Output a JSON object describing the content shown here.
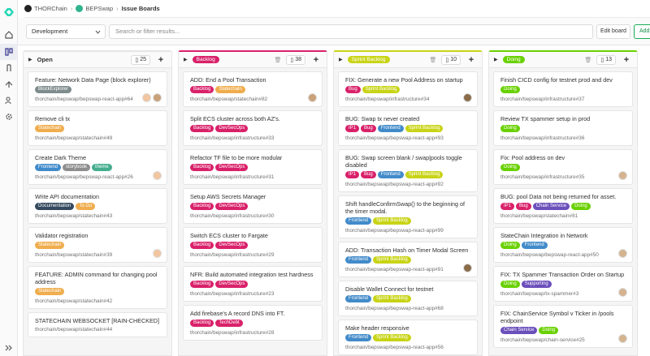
{
  "breadcrumb": [
    "THORChain",
    "BEPSwap",
    "Issue Boards"
  ],
  "filter": {
    "board_select": "Development",
    "search_placeholder": "Search or filter results...",
    "edit_board": "Edit board",
    "add_list": "Add list"
  },
  "colors": {
    "green": "#1aaa55",
    "accent": "#6b4fbb"
  },
  "lists": [
    {
      "title": "Open",
      "label": false,
      "count": "25",
      "top_color": "#e5e5e5",
      "cards": [
        {
          "title": "Feature: Network Data Page (block explorer)",
          "tags": [
            {
              "t": "BlockExplorer",
              "c": "#7f8c8d"
            }
          ],
          "ref": "thorchain/bepswap/bepswap-react-app#64",
          "avatars": 2
        },
        {
          "title": "Remove cli tx",
          "tags": [
            {
              "t": "Statechain",
              "c": "#f0ad4e"
            }
          ],
          "ref": "thorchain/bepswap/statechain#49",
          "avatars": 0
        },
        {
          "title": "Create Dark Theme",
          "tags": [
            {
              "t": "Frontend",
              "c": "#428bca"
            },
            {
              "t": "storybook",
              "c": "#8e8e8e"
            },
            {
              "t": "theme",
              "c": "#44ad8e"
            }
          ],
          "ref": "thorchain/bepswap/bepswap-react-app#26",
          "avatars": 1
        },
        {
          "title": "Write API documentation",
          "tags": [
            {
              "t": "Documentation",
              "c": "#34495e"
            },
            {
              "t": "To Do",
              "c": "#f0ad4e"
            }
          ],
          "ref": "thorchain/bepswap/statechain#43",
          "avatars": 0
        },
        {
          "title": "Validator registration",
          "tags": [
            {
              "t": "Statechain",
              "c": "#f0ad4e"
            }
          ],
          "ref": "thorchain/bepswap/statechain#39",
          "avatars": 1
        },
        {
          "title": "FEATURE: ADMIN command for changing pool address",
          "tags": [
            {
              "t": "Statechain",
              "c": "#f0ad4e"
            }
          ],
          "ref": "thorchain/bepswap/statechain#42",
          "avatars": 0
        },
        {
          "title": "STATECHAIN WEBSOCKET [RAIN-CHECKED]",
          "tags": [],
          "ref": "thorchain/bepswap/statechain#44",
          "avatars": 0
        }
      ]
    },
    {
      "title": "Backlog",
      "label": true,
      "label_color": "#d9216a",
      "count": "38",
      "top_color": "#d9216a",
      "cards": [
        {
          "title": "ADD: End a Pool Transaction",
          "tags": [
            {
              "t": "Backlog",
              "c": "#d9216a"
            },
            {
              "t": "Statechain",
              "c": "#f0ad4e"
            }
          ],
          "ref": "thorchain/bepswap/statechain#82",
          "avatars": 1
        },
        {
          "title": "Split ECS cluster across both AZ's.",
          "tags": [
            {
              "t": "Backlog",
              "c": "#d9216a"
            },
            {
              "t": "DevSecOps",
              "c": "#d9216a"
            }
          ],
          "ref": "thorchain/bepswap/infrastructure#33",
          "avatars": 0
        },
        {
          "title": "Refactor TF file to be more modular",
          "tags": [
            {
              "t": "Backlog",
              "c": "#d9216a"
            },
            {
              "t": "DevSecOps",
              "c": "#d9216a"
            }
          ],
          "ref": "thorchain/bepswap/infrastructure#31",
          "avatars": 0
        },
        {
          "title": "Setup AWS Secrets Manager",
          "tags": [
            {
              "t": "Backlog",
              "c": "#d9216a"
            },
            {
              "t": "DevSecOps",
              "c": "#d9216a"
            }
          ],
          "ref": "thorchain/bepswap/infrastructure#30",
          "avatars": 0
        },
        {
          "title": "Switch ECS cluster to Fargate",
          "tags": [
            {
              "t": "Backlog",
              "c": "#d9216a"
            },
            {
              "t": "DevSecOps",
              "c": "#d9216a"
            }
          ],
          "ref": "thorchain/bepswap/infrastructure#29",
          "avatars": 0
        },
        {
          "title": "NFR: Build automated integration test hardness",
          "tags": [
            {
              "t": "Backlog",
              "c": "#d9216a"
            },
            {
              "t": "DevSecOps",
              "c": "#d9216a"
            }
          ],
          "ref": "thorchain/bepswap/infrastructure#23",
          "avatars": 0
        },
        {
          "title": "Add firebase's A record DNS into FT.",
          "tags": [
            {
              "t": "Backlog",
              "c": "#d9216a"
            },
            {
              "t": "TechDebt",
              "c": "#d9216a"
            }
          ],
          "ref": "thorchain/bepswap/infrastructure#28",
          "avatars": 0
        }
      ]
    },
    {
      "title": "Sprint Backlog",
      "label": true,
      "label_color": "#c8d416",
      "count": "10",
      "top_color": "#c8d416",
      "cards": [
        {
          "title": "FIX: Generate a new Pool Address on startup",
          "tags": [
            {
              "t": "Bug",
              "c": "#d9216a"
            },
            {
              "t": "Sprint Backlog",
              "c": "#c8d416"
            }
          ],
          "ref": "thorchain/bepswap/infrastructure#34",
          "avatars": 1
        },
        {
          "title": "BUG: Swap tx never created",
          "tags": [
            {
              "t": "IP1",
              "c": "#d9216a"
            },
            {
              "t": "Bug",
              "c": "#d9216a"
            },
            {
              "t": "Frontend",
              "c": "#428bca"
            },
            {
              "t": "Sprint Backlog",
              "c": "#c8d416"
            }
          ],
          "ref": "thorchain/bepswap/bepswap-react-app#93",
          "avatars": 0
        },
        {
          "title": "BUG: Swap screen blank / swap|pools toggle disabled",
          "tags": [
            {
              "t": "IP1",
              "c": "#d9216a"
            },
            {
              "t": "Bug",
              "c": "#d9216a"
            },
            {
              "t": "Frontend",
              "c": "#428bca"
            },
            {
              "t": "Sprint Backlog",
              "c": "#c8d416"
            }
          ],
          "ref": "thorchain/bepswap/bepswap-react-app#92",
          "avatars": 0
        },
        {
          "title": "Shift handleConfirmSwap() to the beginning of the timer modal.",
          "tags": [
            {
              "t": "Frontend",
              "c": "#428bca"
            },
            {
              "t": "Sprint Backlog",
              "c": "#c8d416"
            }
          ],
          "ref": "thorchain/bepswap/bepswap-react-app#99",
          "avatars": 0
        },
        {
          "title": "ADD: Transaction Hash on Timer Modal Screen",
          "tags": [
            {
              "t": "Frontend",
              "c": "#428bca"
            },
            {
              "t": "Sprint Backlog",
              "c": "#c8d416"
            }
          ],
          "ref": "thorchain/bepswap/bepswap-react-app#91",
          "avatars": 1
        },
        {
          "title": "Disable Wallet Connect for testnet",
          "tags": [
            {
              "t": "Frontend",
              "c": "#428bca"
            },
            {
              "t": "Sprint Backlog",
              "c": "#c8d416"
            }
          ],
          "ref": "thorchain/bepswap/bepswap-react-app#68",
          "avatars": 0
        },
        {
          "title": "Make header responsive",
          "tags": [
            {
              "t": "Frontend",
              "c": "#428bca"
            },
            {
              "t": "Sprint Backlog",
              "c": "#c8d416"
            }
          ],
          "ref": "thorchain/bepswap/bepswap-react-app#56",
          "avatars": 0
        }
      ]
    },
    {
      "title": "Doing",
      "label": true,
      "label_color": "#69d100",
      "count": "13",
      "top_color": "#69d100",
      "cards": [
        {
          "title": "Finish CICD config for testnet prod and dev",
          "tags": [
            {
              "t": "Doing",
              "c": "#69d100"
            }
          ],
          "ref": "thorchain/bepswap/infrastructure#37",
          "avatars": 0
        },
        {
          "title": "Review TX spammer setup in prod",
          "tags": [
            {
              "t": "Doing",
              "c": "#69d100"
            }
          ],
          "ref": "thorchain/bepswap/infrastructure#36",
          "avatars": 0
        },
        {
          "title": "Fix: Pool address on dev",
          "tags": [
            {
              "t": "Doing",
              "c": "#69d100"
            }
          ],
          "ref": "thorchain/bepswap/infrastructure#35",
          "avatars": 1
        },
        {
          "title": "BUG: pool Data not being returned for asset.",
          "tags": [
            {
              "t": "IP1",
              "c": "#d9216a"
            },
            {
              "t": "Bug",
              "c": "#d9216a"
            },
            {
              "t": "Chain Service",
              "c": "#6b4fbb"
            },
            {
              "t": "Doing",
              "c": "#69d100"
            }
          ],
          "ref": "thorchain/bepswap/statechain#81",
          "avatars": 0
        },
        {
          "title": "StateChain Integration in Network",
          "tags": [
            {
              "t": "Doing",
              "c": "#69d100"
            },
            {
              "t": "Frontend",
              "c": "#428bca"
            }
          ],
          "ref": "thorchain/bepswap/bepswap-react-app#50",
          "avatars": 1
        },
        {
          "title": "FIX: TX Spammer Transaction Order on Startup",
          "tags": [
            {
              "t": "Doing",
              "c": "#69d100"
            },
            {
              "t": "Supporting",
              "c": "#6b4fbb"
            }
          ],
          "ref": "thorchain/bepswap/tx-spammer#3",
          "avatars": 1
        },
        {
          "title": "FIX: ChainService Symbol v Ticker in /pools endpoint",
          "tags": [
            {
              "t": "Chain Service",
              "c": "#6b4fbb"
            },
            {
              "t": "Doing",
              "c": "#69d100"
            }
          ],
          "ref": "thorchain/bepswap/chain-service#25",
          "avatars": 1
        }
      ]
    }
  ]
}
